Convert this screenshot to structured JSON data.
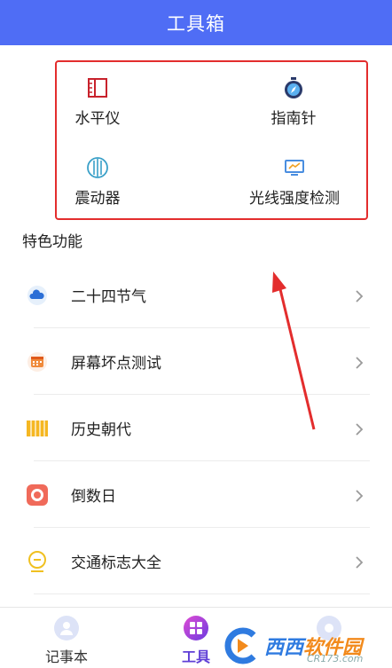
{
  "header": {
    "title": "工具箱"
  },
  "tools": [
    {
      "label": "水平仪",
      "icon": "level-icon"
    },
    {
      "label": "指南针",
      "icon": "compass-icon"
    },
    {
      "label": "震动器",
      "icon": "vibrate-icon"
    },
    {
      "label": "光线强度检测",
      "icon": "light-meter-icon"
    }
  ],
  "featured": {
    "title": "特色功能",
    "items": [
      {
        "label": "二十四节气",
        "icon": "cloud-icon"
      },
      {
        "label": "屏幕坏点测试",
        "icon": "calendar-icon"
      },
      {
        "label": "历史朝代",
        "icon": "scroll-icon"
      },
      {
        "label": "倒数日",
        "icon": "countdown-icon"
      },
      {
        "label": "交通标志大全",
        "icon": "traffic-sign-icon"
      }
    ]
  },
  "bottom_nav": {
    "items": [
      {
        "label": "记事本",
        "active": false
      },
      {
        "label": "工具",
        "active": true
      },
      {
        "label": "",
        "active": false
      }
    ]
  },
  "watermark": {
    "text_blue": "西西",
    "text_orange": "软件园",
    "site": "CR173.com"
  },
  "colors": {
    "header": "#4f6df5",
    "highlight_box": "#e32d2d",
    "active_tab": "#5f3fd6",
    "arrow": "#e32d2d"
  }
}
